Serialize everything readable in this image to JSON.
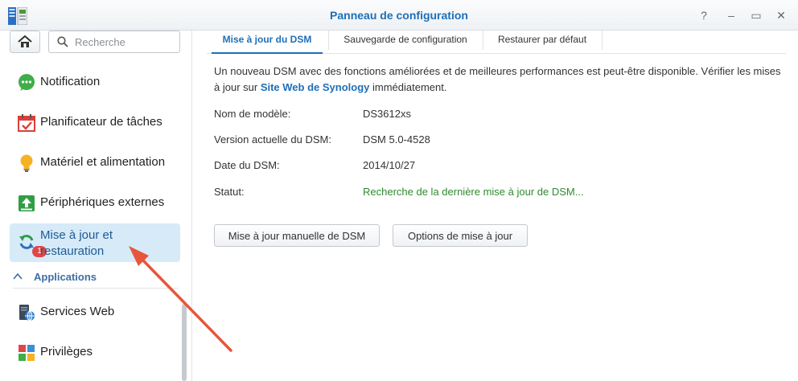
{
  "window": {
    "title": "Panneau de configuration",
    "controls": {
      "help": "?",
      "minimize": "–",
      "maximize": "▭",
      "close": "✕"
    }
  },
  "sidebar": {
    "search_placeholder": "Recherche",
    "items": [
      {
        "label": "Notification",
        "icon": "chat-bubble-icon"
      },
      {
        "label": "Planificateur de tâches",
        "icon": "calendar-check-icon"
      },
      {
        "label": "Matériel et alimentation",
        "icon": "lightbulb-icon"
      },
      {
        "label": "Périphériques externes",
        "icon": "upload-device-icon"
      },
      {
        "label": "Mise à jour et restauration",
        "icon": "refresh-icon",
        "badge": "1",
        "active": true
      }
    ],
    "section_header": "Applications",
    "app_items": [
      {
        "label": "Services Web",
        "icon": "web-server-icon"
      },
      {
        "label": "Privilèges",
        "icon": "privileges-grid-icon"
      }
    ]
  },
  "tabs": [
    {
      "label": "Mise à jour du DSM",
      "active": true
    },
    {
      "label": "Sauvegarde de configuration"
    },
    {
      "label": "Restaurer par défaut"
    }
  ],
  "content": {
    "intro_before": "Un nouveau DSM avec des fonctions améliorées et de meilleures performances est peut-être disponible. Vérifier les mises à jour sur ",
    "intro_link": "Site Web de Synology",
    "intro_after": " immédiatement.",
    "rows": [
      {
        "label": "Nom de modèle:",
        "value": "DS3612xs"
      },
      {
        "label": "Version actuelle du DSM:",
        "value": "DSM 5.0-4528"
      },
      {
        "label": "Date du DSM:",
        "value": "2014/10/27"
      },
      {
        "label": "Statut:",
        "value": "Recherche de la dernière mise à jour de DSM..."
      }
    ],
    "buttons": {
      "manual_update": "Mise à jour manuelle de DSM",
      "update_options": "Options de mise à jour"
    }
  },
  "colors": {
    "accent": "#1e6fb8",
    "status_green": "#2e8b2e",
    "active_item_bg": "#d6eaf8",
    "annotation_arrow": "#e8553a",
    "badge": "#e04646"
  }
}
